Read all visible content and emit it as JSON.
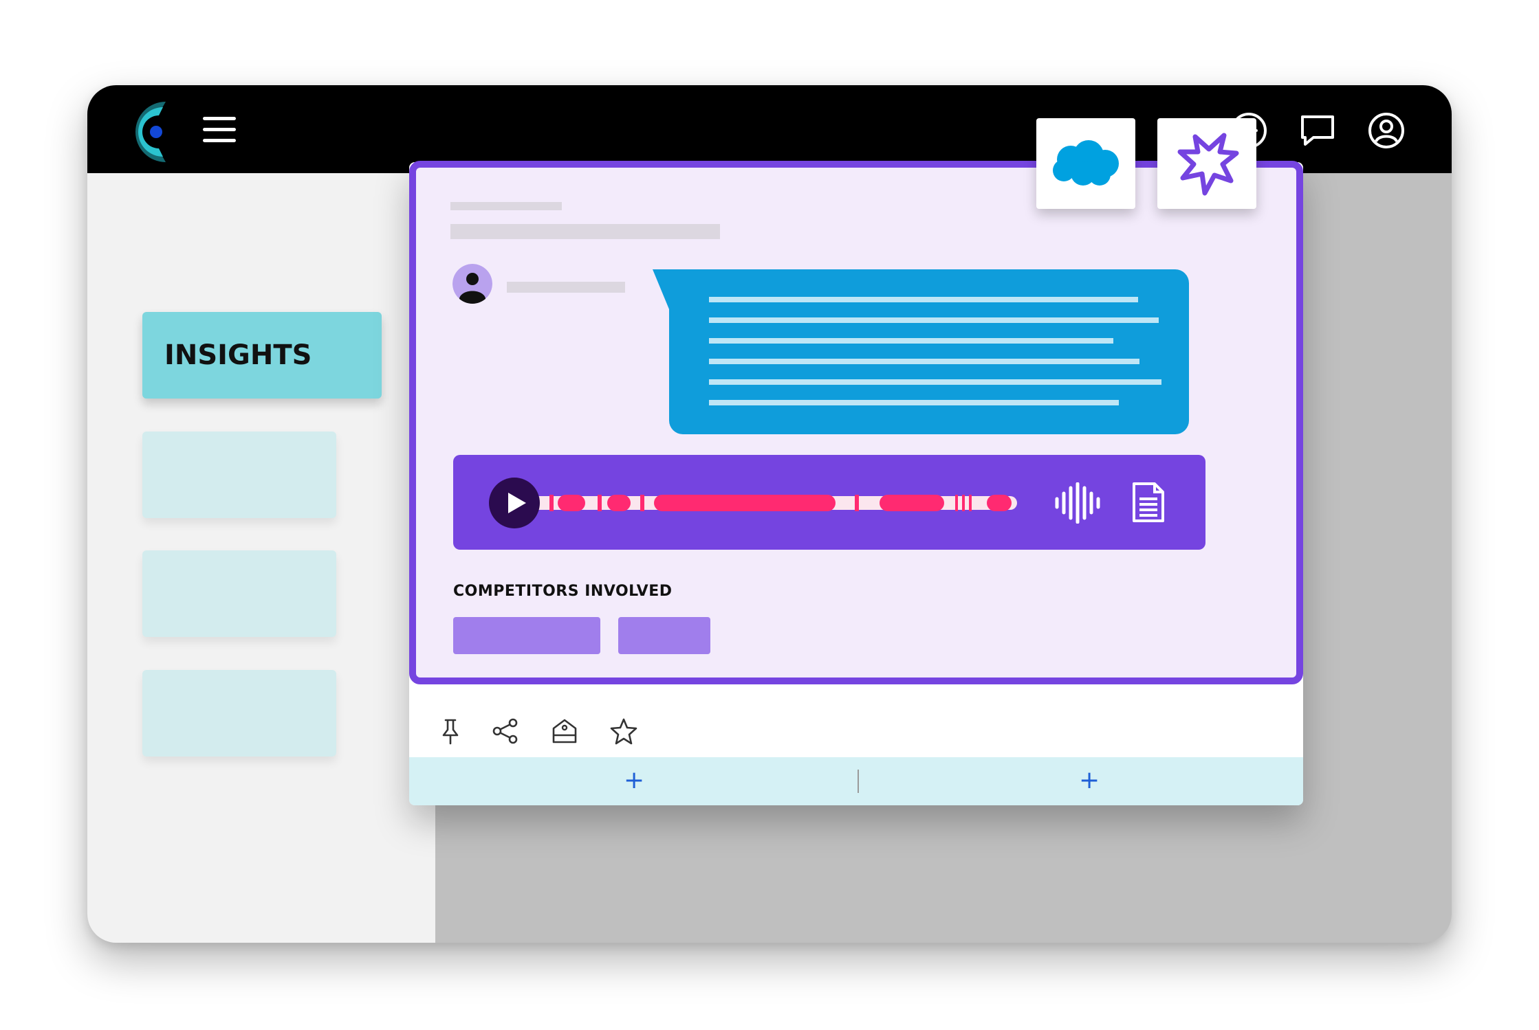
{
  "sidebar": {
    "active_item_label": "INSIGHTS"
  },
  "card": {
    "section_title": "COMPETITORS INVOLVED"
  },
  "footer": {
    "left_add_label": "+",
    "right_add_label": "+"
  },
  "icons": {
    "topbar": [
      "logo-icon",
      "hamburger-menu-icon",
      "plus-circle-icon",
      "chat-bubble-icon",
      "user-circle-icon"
    ],
    "player": [
      "play-icon",
      "waveform-icon",
      "document-icon"
    ],
    "actions": [
      "pin-icon",
      "share-icon",
      "tag-icon",
      "star-icon"
    ],
    "integrations": [
      "salesforce-cloud-icon",
      "burst-star-icon"
    ]
  },
  "colors": {
    "accent_purple": "#7544e0",
    "card_background": "#f3ebfb",
    "message_bubble": "#0f9ddb",
    "nav_active": "#7dd6de",
    "nav_inactive": "#d3ecee",
    "playback_track": "#ff2a71",
    "chip": "#a07eec",
    "topbar": "#000000",
    "footer_row": "#d5f1f5",
    "salesforce_blue": "#00a1e0"
  }
}
